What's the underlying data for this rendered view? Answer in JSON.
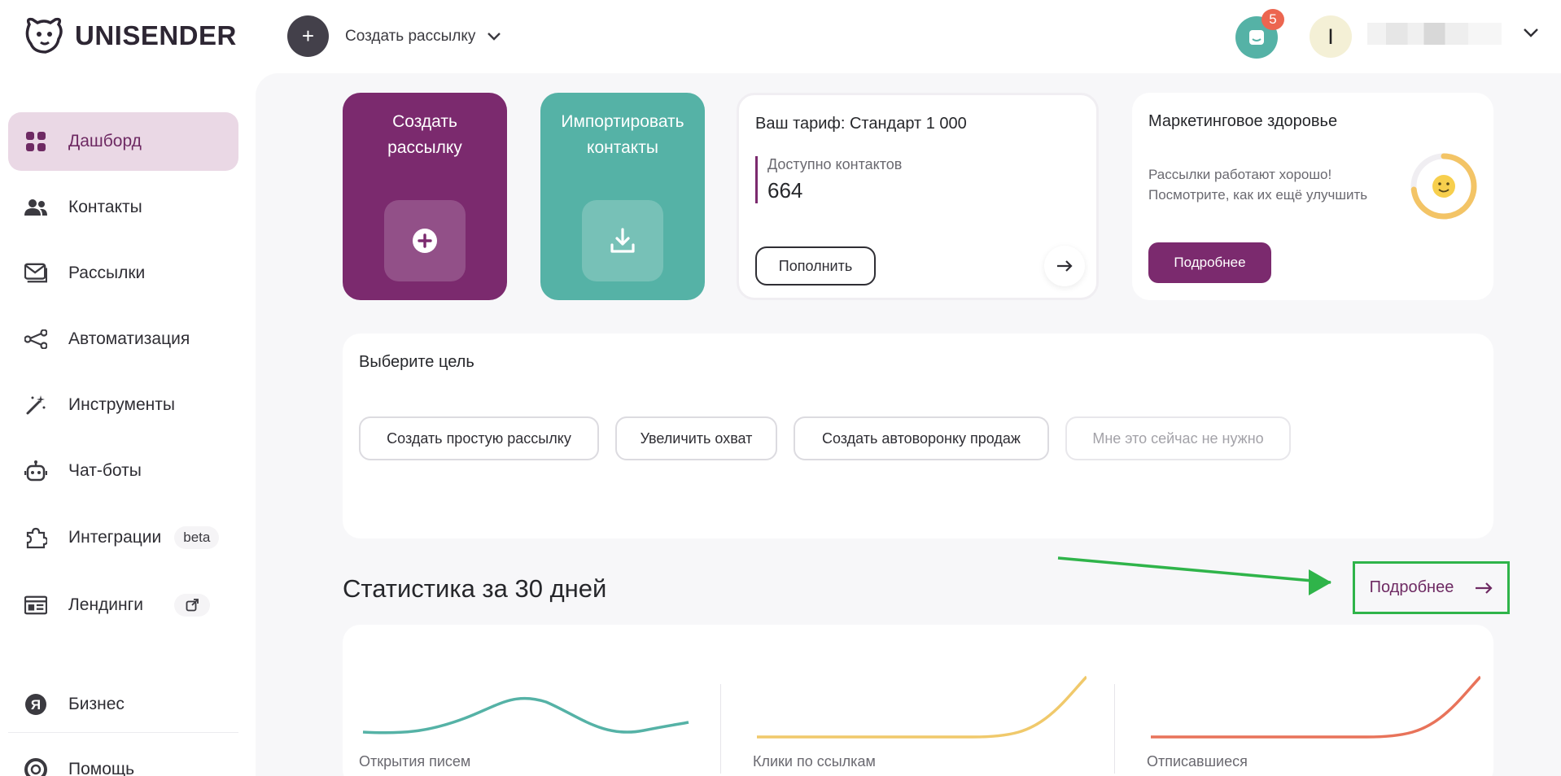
{
  "brand": {
    "name": "UNISENDER"
  },
  "header": {
    "create_label": "Создать рассылку",
    "notifications_count": "5",
    "avatar_letter": "I"
  },
  "sidebar": {
    "items": [
      {
        "label": "Дашборд",
        "icon": "grid-icon",
        "active": true
      },
      {
        "label": "Контакты",
        "icon": "people-icon"
      },
      {
        "label": "Рассылки",
        "icon": "mail-icon"
      },
      {
        "label": "Автоматизация",
        "icon": "flow-icon"
      },
      {
        "label": "Инструменты",
        "icon": "magic-wand-icon"
      },
      {
        "label": "Чат-боты",
        "icon": "robot-icon"
      },
      {
        "label": "Интеграции",
        "icon": "puzzle-icon",
        "badge": "beta"
      },
      {
        "label": "Лендинги",
        "icon": "landing-icon",
        "external": true
      },
      {
        "label": "Бизнес",
        "icon": "yandex-icon"
      },
      {
        "label": "Помощь",
        "icon": "help-icon"
      }
    ]
  },
  "quick_actions": [
    {
      "label": "Создать рассылку",
      "color": "#7b2a6e"
    },
    {
      "label": "Импортировать контакты",
      "color": "#55b2a6"
    }
  ],
  "tariff": {
    "title": "Ваш тариф: Стандарт 1 000",
    "contacts_label": "Доступно контактов",
    "contacts_value": "664",
    "topup_button": "Пополнить"
  },
  "health": {
    "title": "Маркетинговое здоровье",
    "line1": "Рассылки работают хорошо!",
    "line2": "Посмотрите, как их ещё улучшить",
    "button": "Подробнее"
  },
  "goal": {
    "title": "Выберите цель",
    "options": [
      "Создать простую рассылку",
      "Увеличить охват",
      "Создать автоворонку продаж",
      "Мне это сейчас не нужно"
    ]
  },
  "stats": {
    "heading": "Статистика за 30 дней",
    "more_link": "Подробнее",
    "metrics": [
      {
        "label": "Открытия писем",
        "color": "#55b2a6"
      },
      {
        "label": "Клики по ссылкам",
        "color": "#f0c96b"
      },
      {
        "label": "Отписавшиеся",
        "color": "#e8735a"
      }
    ]
  },
  "colors": {
    "accent": "#7b2a6e",
    "teal": "#55b2a6",
    "highlight": "#2fb44a"
  }
}
